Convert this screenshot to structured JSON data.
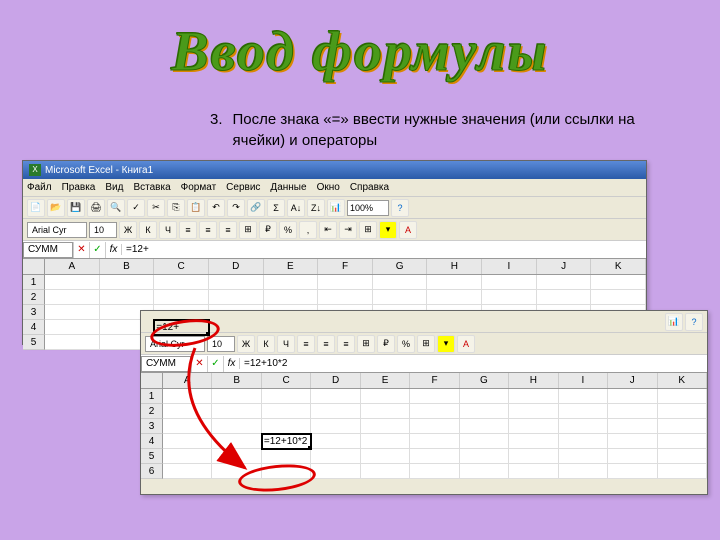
{
  "title": "Ввод формулы",
  "instruction": {
    "number": "3.",
    "text": "После знака «=» ввести нужные значения (или ссылки на ячейки) и операторы"
  },
  "excel1": {
    "app_title": "Microsoft Excel - Книга1",
    "menu": [
      "Файл",
      "Правка",
      "Вид",
      "Вставка",
      "Формат",
      "Сервис",
      "Данные",
      "Окно",
      "Справка"
    ],
    "font_name": "Arial Cyr",
    "font_size": "10",
    "zoom": "100%",
    "namebox": "СУММ",
    "formula": "=12+",
    "columns": [
      "A",
      "B",
      "C",
      "D",
      "E",
      "F",
      "G",
      "H",
      "I",
      "J",
      "K"
    ],
    "rows": [
      "1",
      "2",
      "3",
      "4",
      "5"
    ],
    "active_cell": {
      "row": 4,
      "col": "C",
      "value": "=12+"
    }
  },
  "excel2": {
    "font_name": "Arial Cyr",
    "font_size": "10",
    "namebox": "СУММ",
    "formula": "=12+10*2",
    "columns": [
      "A",
      "B",
      "C",
      "D",
      "E",
      "F",
      "G",
      "H",
      "I",
      "J",
      "K"
    ],
    "rows": [
      "1",
      "2",
      "3",
      "4",
      "5",
      "6"
    ],
    "active_cell": {
      "row": 4,
      "col": "C",
      "value": "=12+10*2"
    }
  },
  "icons": {
    "bold": "Ж",
    "italic": "К",
    "underline": "Ч",
    "cancel": "✕",
    "confirm": "✓",
    "fx": "fx"
  }
}
